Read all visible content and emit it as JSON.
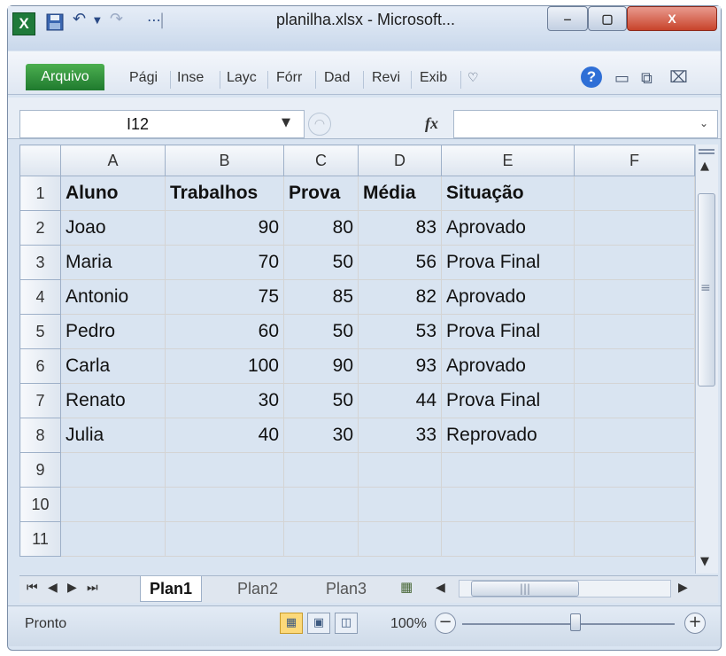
{
  "window": {
    "title": "planilha.xlsx - Microsoft..."
  },
  "title_buttons": {
    "minimize": "‒",
    "maximize": "▢",
    "close": "X"
  },
  "quick_access": {
    "app_icon": "X",
    "save_icon": "floppy-icon",
    "undo_icon": "undo-icon",
    "redo_icon": "redo-icon"
  },
  "ribbon": {
    "file_tab": "Arquivo",
    "tabs": [
      "Pági",
      "Inse",
      "Layc",
      "Fórr",
      "Dad",
      "Revi",
      "Exib"
    ],
    "icons": [
      "minimize-ribbon-icon",
      "help-icon",
      "restore-icon",
      "close-icon"
    ]
  },
  "formula_bar": {
    "name_box": "I12",
    "fx": "fx",
    "formula": ""
  },
  "sheet": {
    "columns": [
      "A",
      "B",
      "C",
      "D",
      "E",
      "F"
    ],
    "rows": [
      {
        "num": "1",
        "cells": [
          "Aluno",
          "Trabalhos",
          "Prova",
          "Média",
          "Situação",
          ""
        ]
      },
      {
        "num": "2",
        "cells": [
          "Joao",
          "90",
          "80",
          "83",
          "Aprovado",
          ""
        ]
      },
      {
        "num": "3",
        "cells": [
          "Maria",
          "70",
          "50",
          "56",
          "Prova Final",
          ""
        ]
      },
      {
        "num": "4",
        "cells": [
          "Antonio",
          "75",
          "85",
          "82",
          "Aprovado",
          ""
        ]
      },
      {
        "num": "5",
        "cells": [
          "Pedro",
          "60",
          "50",
          "53",
          "Prova Final",
          ""
        ]
      },
      {
        "num": "6",
        "cells": [
          "Carla",
          "100",
          "90",
          "93",
          "Aprovado",
          ""
        ]
      },
      {
        "num": "7",
        "cells": [
          "Renato",
          "30",
          "50",
          "44",
          "Prova Final",
          ""
        ]
      },
      {
        "num": "8",
        "cells": [
          "Julia",
          "40",
          "30",
          "33",
          "Reprovado",
          ""
        ]
      },
      {
        "num": "9",
        "cells": [
          "",
          "",
          "",
          "",
          "",
          ""
        ]
      },
      {
        "num": "10",
        "cells": [
          "",
          "",
          "",
          "",
          "",
          ""
        ]
      },
      {
        "num": "11",
        "cells": [
          "",
          "",
          "",
          "",
          "",
          ""
        ]
      }
    ]
  },
  "sheet_tabs": {
    "nav": [
      "⏮",
      "◀",
      "▶",
      "⏭"
    ],
    "tabs": [
      "Plan1",
      "Plan2",
      "Plan3"
    ],
    "active": "Plan1"
  },
  "statusbar": {
    "status": "Pronto",
    "zoom": "100%",
    "zoom_level_percent": 100,
    "zoom_out": "−",
    "zoom_in": "+"
  }
}
